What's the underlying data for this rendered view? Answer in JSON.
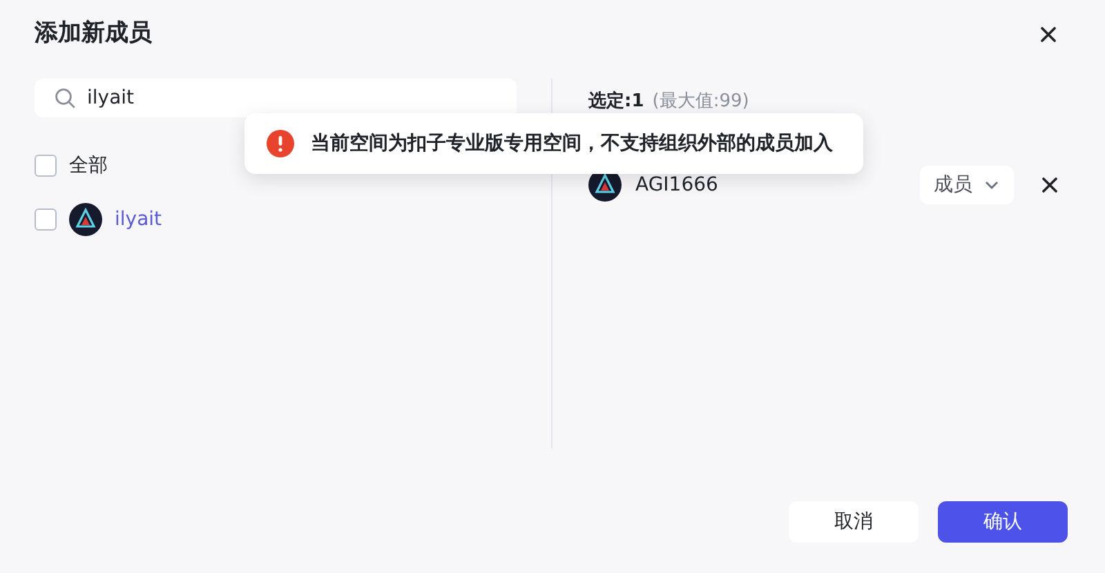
{
  "dialog": {
    "title": "添加新成员"
  },
  "search": {
    "value": "ilyait"
  },
  "candidates": {
    "select_all": {
      "label": "全部",
      "checked": false
    },
    "items": [
      {
        "name": "ilyait",
        "checked": false
      }
    ]
  },
  "selected_panel": {
    "count_label": "选定:1",
    "max_label": "(最大值:99)",
    "members": [
      {
        "name": "AGI1666",
        "role": "成员"
      }
    ]
  },
  "toast": {
    "kind": "error",
    "message": "当前空间为扣子专业版专用空间，不支持组织外部的成员加入"
  },
  "buttons": [
    {
      "label": "取消",
      "kind": "secondary"
    },
    {
      "label": "确认",
      "kind": "primary"
    }
  ]
}
